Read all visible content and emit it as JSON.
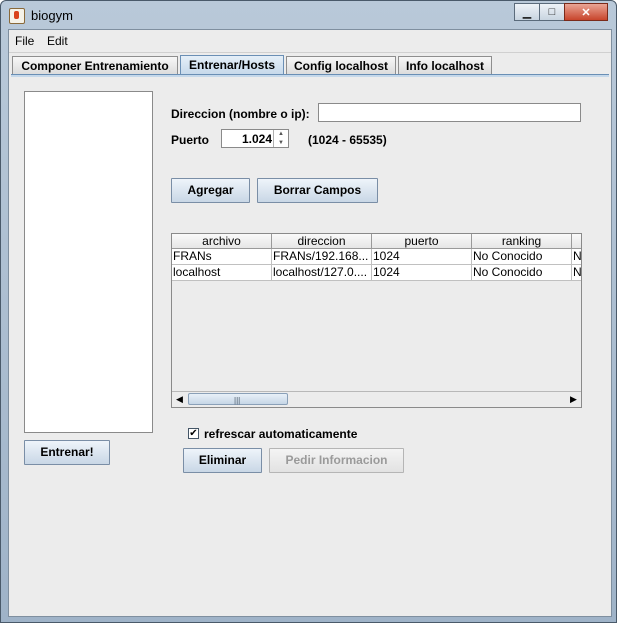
{
  "window": {
    "title": "biogym"
  },
  "menu": [
    "File",
    "Edit"
  ],
  "tabs": [
    "Componer Entrenamiento",
    "Entrenar/Hosts",
    "Config localhost",
    "Info localhost"
  ],
  "form": {
    "direccion_label": "Direccion (nombre o ip):",
    "direccion_value": "",
    "puerto_label": "Puerto",
    "puerto_value": "1.024",
    "puerto_range": "(1024 - 65535)"
  },
  "buttons": {
    "agregar": "Agregar",
    "borrar": "Borrar Campos",
    "entrenar": "Entrenar!",
    "eliminar": "Eliminar",
    "pedir": "Pedir Informacion"
  },
  "table": {
    "columns": [
      "archivo",
      "direccion",
      "puerto",
      "ranking",
      ""
    ],
    "rows": [
      [
        "FRANs",
        "FRANs/192.168...",
        "1024",
        "No Conocido",
        "N"
      ],
      [
        "localhost",
        "localhost/127.0....",
        "1024",
        "No Conocido",
        "N"
      ]
    ]
  },
  "refresh": {
    "label": "refrescar automaticamente",
    "checked": true
  }
}
